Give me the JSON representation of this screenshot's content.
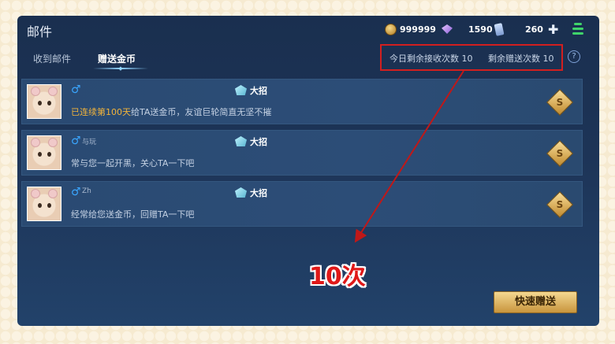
{
  "title": "邮件",
  "resources": {
    "gold": "999999",
    "gems": "1590",
    "tickets": "260"
  },
  "tabs": [
    {
      "label": "收到邮件",
      "active": false
    },
    {
      "label": "赠送金币",
      "active": true
    }
  ],
  "counts": {
    "receive": "今日剩余接收次数 10",
    "send": "剩余赠送次数 10"
  },
  "friends": [
    {
      "nick": "",
      "rank": "大招",
      "message_pre": "",
      "message_highlight": "已连续第100天",
      "message_post": "给TA送金币，友谊巨轮简直无坚不摧"
    },
    {
      "nick": "与玩",
      "rank": "大招",
      "message_pre": "常与您一起开黑，关心TA一下吧",
      "message_highlight": "",
      "message_post": ""
    },
    {
      "nick": "Zh",
      "rank": "大招",
      "message_pre": "经常给您送金币，回赠TA一下吧",
      "message_highlight": "",
      "message_post": ""
    }
  ],
  "annotation": "10次",
  "quick_send_label": "快速赠送",
  "icons": {
    "gold": "gold-coin-icon",
    "gems": "gem-icon",
    "tickets": "ticket-icon",
    "add": "plus-icon",
    "signal": "signal-icon",
    "help": "help-icon",
    "gender": "male-icon",
    "rank": "rank-badge-icon",
    "gift": "gift-coin-icon"
  },
  "colors": {
    "annotation_red": "#d21f1f",
    "highlight_text": "#f2b43b",
    "button_gold": "#e3bd6a"
  }
}
